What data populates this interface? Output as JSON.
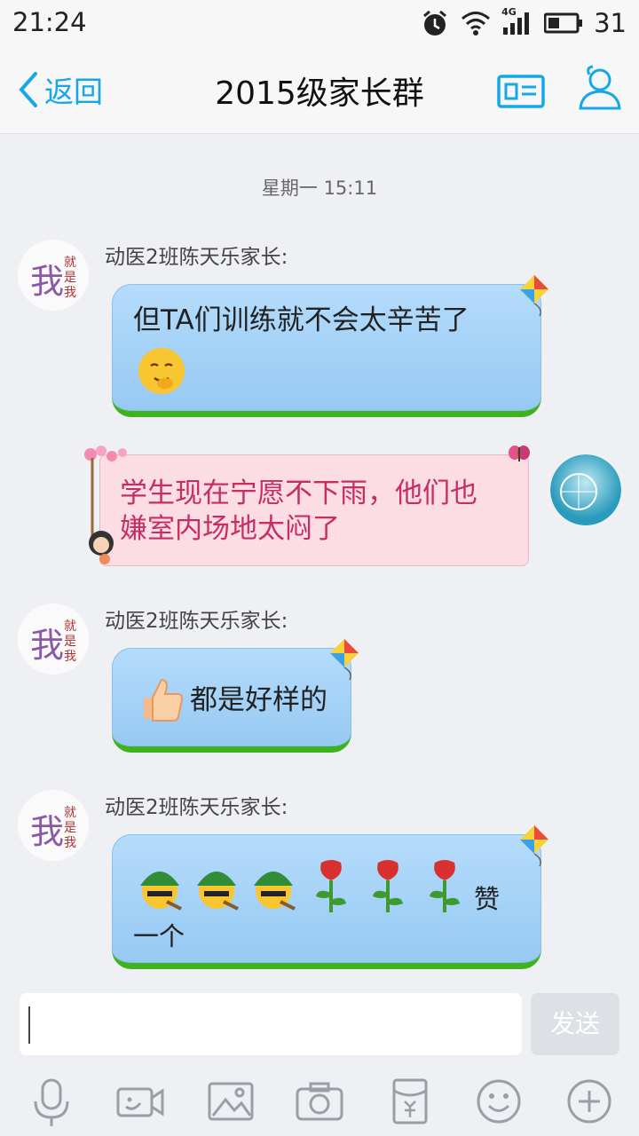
{
  "status_bar": {
    "time": "21:24",
    "network": "4G",
    "battery": "31"
  },
  "header": {
    "back_label": "返回",
    "title": "2015级家长群"
  },
  "chat": {
    "timestamp": "星期一 15:11",
    "messages": [
      {
        "sender": "动医2班陈天乐家长:",
        "text": "但TA们训练就不会太辛苦了",
        "avatar_text": "我",
        "avatar_sub": "就是我"
      },
      {
        "text_line1": "学生现在宁愿不下雨，他们也",
        "text_line2": "嫌室内场地太闷了"
      },
      {
        "sender": "动医2班陈天乐家长:",
        "text": "都是好样的"
      },
      {
        "sender": "动医2班陈天乐家长:",
        "text_suffix": "赞",
        "text_line2": "一个"
      }
    ]
  },
  "input": {
    "placeholder": "",
    "send_label": "发送"
  },
  "toolbar": {
    "items": [
      "microphone-icon",
      "video-call-icon",
      "image-icon",
      "camera-icon",
      "red-packet-icon",
      "emoji-icon",
      "plus-icon"
    ]
  },
  "colors": {
    "accent": "#16a8e6",
    "bubble_blue": "#a6d3f7",
    "bubble_pink": "#fcdde4",
    "pink_text": "#c62d65"
  }
}
